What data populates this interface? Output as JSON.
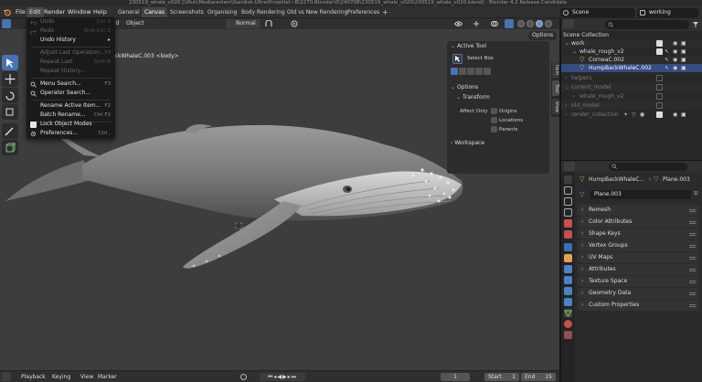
{
  "titlebar": {
    "text": "230519_whale_v020 [\\\\Ruh\\Mediarenlem\\Sandisk-Ultra\\Projekte\\~B\\2270-Blender\\0\\240708\\230519_whale_v020\\230519_whale_v020.blend] - Blender 4.2 Release Candidate"
  },
  "menubar": {
    "items": [
      "File",
      "Edit",
      "Render",
      "Window",
      "Help"
    ],
    "tabs": [
      "General",
      "Canvas",
      "Screenshots",
      "Organising",
      "Body Rendering",
      "Old vs New Rendering",
      "Preferences"
    ],
    "active_tab": "Canvas",
    "add_tab": "+",
    "scene_label": "Scene",
    "view_layer_label": "working"
  },
  "viewport": {
    "header_items": [
      "ld",
      "Object"
    ],
    "transform_orientation": "Normal",
    "object_label": "ackWhaleC.003 <body>",
    "options_label": "Options",
    "shading_modes": [
      "wireframe-icon",
      "solid-icon",
      "material-icon",
      "rendered-icon"
    ],
    "active_shading": "material-icon"
  },
  "edit_menu": {
    "items": [
      {
        "label": "Undo",
        "shortcut": "Ctrl Z",
        "disabled": true
      },
      {
        "label": "Redo",
        "shortcut": "Shift Ctrl Z",
        "disabled": true
      },
      {
        "label": "Undo History",
        "shortcut": "",
        "disabled": false,
        "submenu": true
      },
      {
        "label": "Adjust Last Operation...",
        "shortcut": "F9",
        "disabled": true
      },
      {
        "label": "Repeat Last",
        "shortcut": "Shift R",
        "disabled": true
      },
      {
        "label": "Repeat History...",
        "shortcut": "",
        "disabled": true
      },
      {
        "label": "Menu Search...",
        "shortcut": "F3",
        "disabled": false
      },
      {
        "label": "Operator Search...",
        "shortcut": "",
        "disabled": false
      },
      {
        "label": "Rename Active Item...",
        "shortcut": "F2",
        "disabled": false
      },
      {
        "label": "Batch Rename...",
        "shortcut": "Ctrl F2",
        "disabled": false
      },
      {
        "label": "Lock Object Modes",
        "shortcut": "",
        "disabled": false
      },
      {
        "label": "Preferences...",
        "shortcut": "Ctrl ,",
        "disabled": false
      }
    ]
  },
  "npanel": {
    "active_tool_header": "Active Tool",
    "active_tool_name": "Select Box",
    "options_header": "Options",
    "transform_header": "Transform",
    "affect_only_label": "Affect Only",
    "affect_only_options": [
      "Origins",
      "Locations",
      "Parents"
    ],
    "workspace_header": "Workspace",
    "tabs": [
      "Item",
      "Tool",
      "View"
    ],
    "active_tab": "Tool"
  },
  "outliner": {
    "search_placeholder": "",
    "rows": [
      {
        "label": "Scene Collection",
        "indent": 0,
        "dim": false
      },
      {
        "label": "work",
        "indent": 1,
        "dim": false
      },
      {
        "label": "whale_rough_v2",
        "indent": 2,
        "dim": false
      },
      {
        "label": "CorneaC.002",
        "indent": 3,
        "dim": false
      },
      {
        "label": "HumpBackWhaleC.002",
        "indent": 3,
        "dim": false
      },
      {
        "label": "helpers",
        "indent": 1,
        "dim": true
      },
      {
        "label": "current_model",
        "indent": 1,
        "dim": true
      },
      {
        "label": "whale_rough_v2",
        "indent": 2,
        "dim": true
      },
      {
        "label": "old_model",
        "indent": 1,
        "dim": true
      },
      {
        "label": "render_collection",
        "indent": 1,
        "dim": true
      }
    ]
  },
  "properties": {
    "search_placeholder": "",
    "object_name": "HumpBackWhaleC...",
    "mesh_name": "Plane.003",
    "data_name": "Plane.003",
    "sections": [
      "Remesh",
      "Color Attributes",
      "Shape Keys",
      "Vertex Groups",
      "UV Maps",
      "Attributes",
      "Texture Space",
      "Geometry Data",
      "Custom Properties"
    ]
  },
  "timeline": {
    "items": [
      "Playback",
      "Keying",
      "View",
      "Marker"
    ],
    "current_frame": "1",
    "start_label": "Start",
    "start_value": "1",
    "end_label": "End",
    "end_value": "15"
  },
  "colors": {
    "accent": "#4772b3",
    "selection": "#334d80",
    "viewport_bg": "#3d3d3d"
  }
}
